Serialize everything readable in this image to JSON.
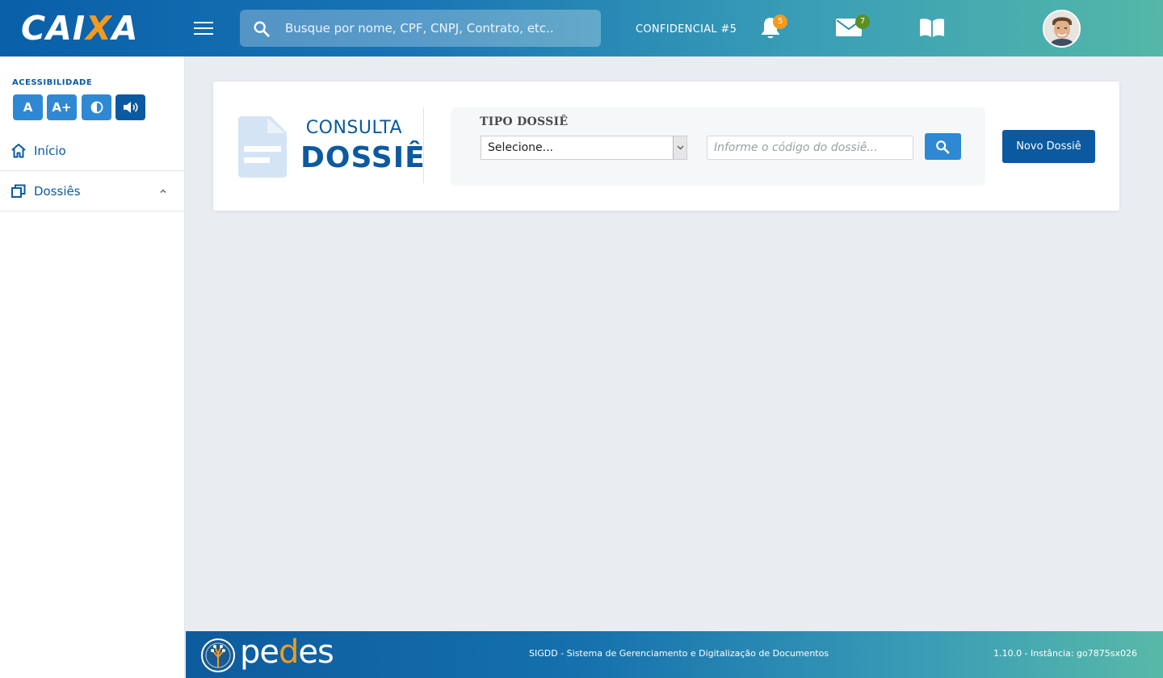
{
  "header": {
    "logo_prefix": "CAI",
    "logo_x": "X",
    "logo_suffix": "A",
    "search_placeholder": "Busque por nome, CPF, CNPJ, Contrato, etc..",
    "confidential_label": "CONFIDENCIAL #5",
    "notifications_count": "5",
    "messages_count": "7"
  },
  "sidebar": {
    "accessibility_label": "ACESSIBILIDADE",
    "accessibility_buttons": [
      "A",
      "A+"
    ],
    "items": [
      {
        "label": "Início",
        "icon": "home-icon"
      },
      {
        "label": "Dossiês",
        "icon": "dossiers-icon"
      }
    ]
  },
  "main": {
    "title_line1": "CONSULTA",
    "title_line2": "DOSSIÊ",
    "tipo_label": "TIPO DOSSIÊ",
    "select_value": "Selecione...",
    "code_placeholder": "Informe o código do dossiê...",
    "new_button": "Novo Dossiê"
  },
  "footer": {
    "brand_pe": "pe",
    "brand_d": "d",
    "brand_es": "es",
    "system_name": "SIGDD - Sistema de Gerenciamento e Digitalização de Documentos",
    "version": "1.10.0 - Instância: go7875sx026"
  },
  "colors": {
    "primary": "#0b5aa1",
    "accent": "#f39a1f",
    "button_blue": "#2f88d3"
  }
}
